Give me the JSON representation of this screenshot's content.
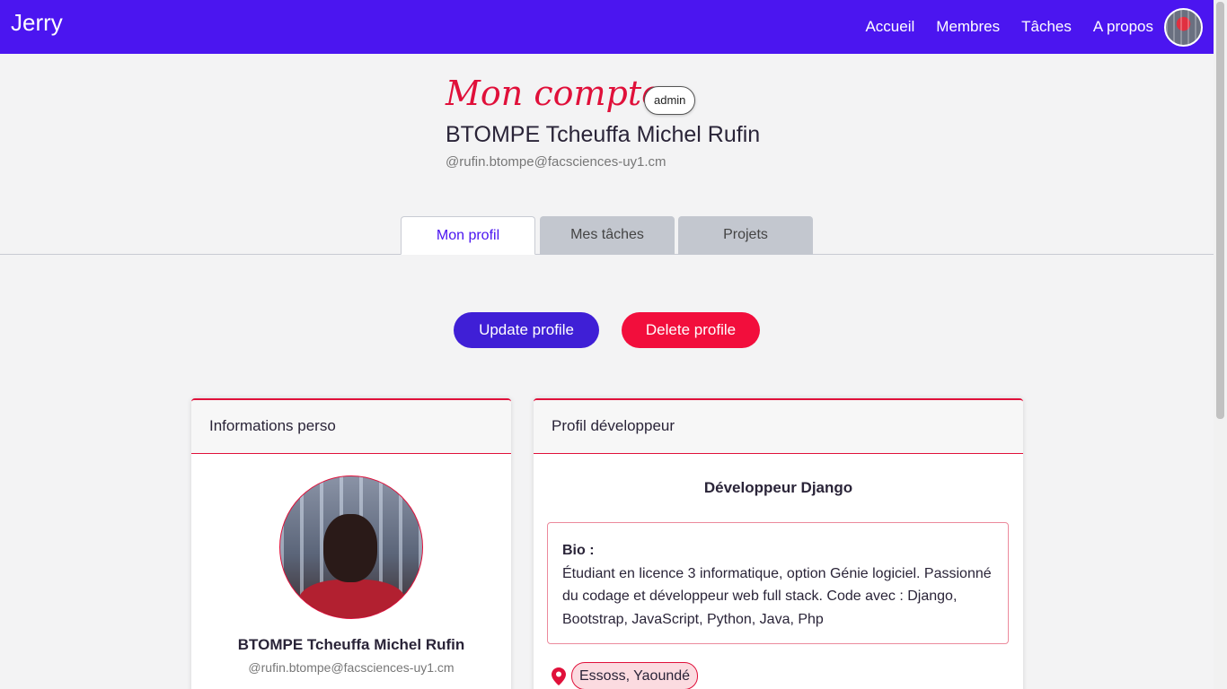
{
  "navbar": {
    "brand": "Jerry",
    "links": [
      "Accueil",
      "Membres",
      "Tâches",
      "A propos"
    ],
    "bg_color": "#4b15f0"
  },
  "header": {
    "title": "Mon compte",
    "role_badge": "admin",
    "name": "BTOMPE Tcheuffa Michel Rufin",
    "email": "@rufin.btompe@facsciences-uy1.cm"
  },
  "tabs": [
    {
      "label": "Mon profil",
      "active": true
    },
    {
      "label": "Mes tâches",
      "active": false
    },
    {
      "label": "Projets",
      "active": false
    }
  ],
  "actions": {
    "update_label": "Update profile",
    "delete_label": "Delete profile"
  },
  "personal_card": {
    "header": "Informations perso",
    "name": "BTOMPE Tcheuffa Michel Rufin",
    "email": "@rufin.btompe@facsciences-uy1.cm"
  },
  "dev_card": {
    "header": "Profil développeur",
    "title": "Développeur Django",
    "bio_label": "Bio :",
    "bio_text": "Étudiant en licence 3 informatique, option Génie logiciel. Passionné du codage et développeur web full stack. Code avec : Django, Bootstrap, JavaScript, Python, Java, Php",
    "location": "Essoss, Yaoundé"
  },
  "colors": {
    "accent": "#e0103a",
    "primary": "#3f1fd6",
    "danger": "#f20e3c"
  }
}
